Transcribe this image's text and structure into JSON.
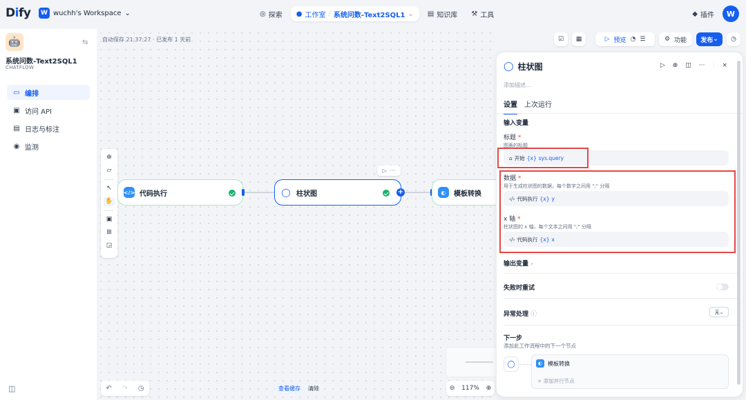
{
  "topbar": {
    "logo": {
      "pre": "D",
      "i": "i",
      "post": "fy"
    },
    "workspace_badge": "W",
    "workspace_name": "wuchh's Workspace",
    "nav": {
      "explore": "探索",
      "studio": "工作室",
      "app": "系统问数-Text2SQL1",
      "knowledge": "知识库",
      "tools": "工具"
    },
    "plugins": "插件",
    "avatar": "W"
  },
  "sidebar": {
    "app_icon": "🤖",
    "app_title": "系统问数-Text2SQL1",
    "app_type": "CHATFLOW",
    "items": [
      {
        "icon": "▭",
        "label": "编排"
      },
      {
        "icon": "▣",
        "label": "访问 API"
      },
      {
        "icon": "▤",
        "label": "日志与标注"
      },
      {
        "icon": "◉",
        "label": "监测"
      }
    ]
  },
  "canvas": {
    "autosave": "自动保存 21:37:27 · 已发布 1 天前",
    "nodes": [
      {
        "title": "代码执行",
        "icon": "</>"
      },
      {
        "title": "柱状图",
        "icon": "◯"
      },
      {
        "title": "模板转换",
        "icon": "◐"
      }
    ],
    "bottom": {
      "view_cache": "查看缓存",
      "clear": "清除",
      "zoom": "117%"
    }
  },
  "toolbar": {
    "preview": "预览",
    "features": "功能",
    "publish": "发布"
  },
  "panel": {
    "title": "柱状图",
    "description_placeholder": "添加描述...",
    "tabs": [
      "设置",
      "上次运行"
    ],
    "input_vars_title": "输入变量",
    "fields": [
      {
        "label": "标题",
        "desc": "图表的标题",
        "node": "开始",
        "var": "sys.query"
      },
      {
        "label": "数据",
        "desc": "用于生成柱状图的数据，每个数字之间用 \";\" 分隔",
        "node": "代码执行",
        "var": "y"
      },
      {
        "label": "x 轴",
        "desc": "柱状图的 x 轴，每个文本之间用 \";\" 分隔",
        "node": "代码执行",
        "var": "x"
      }
    ],
    "output_vars": "输出变量",
    "retry_on_fail": "失败时重试",
    "error_handling": "异常处理",
    "error_handling_value": "无",
    "next_step_title": "下一步",
    "next_step_desc": "添加此工作流程中的下一个节点",
    "next_node": "模板转换",
    "add_parallel": "添加并行节点"
  },
  "colors": {
    "accent": "#155eef",
    "success": "#17b26a",
    "highlight": "#e64545"
  }
}
